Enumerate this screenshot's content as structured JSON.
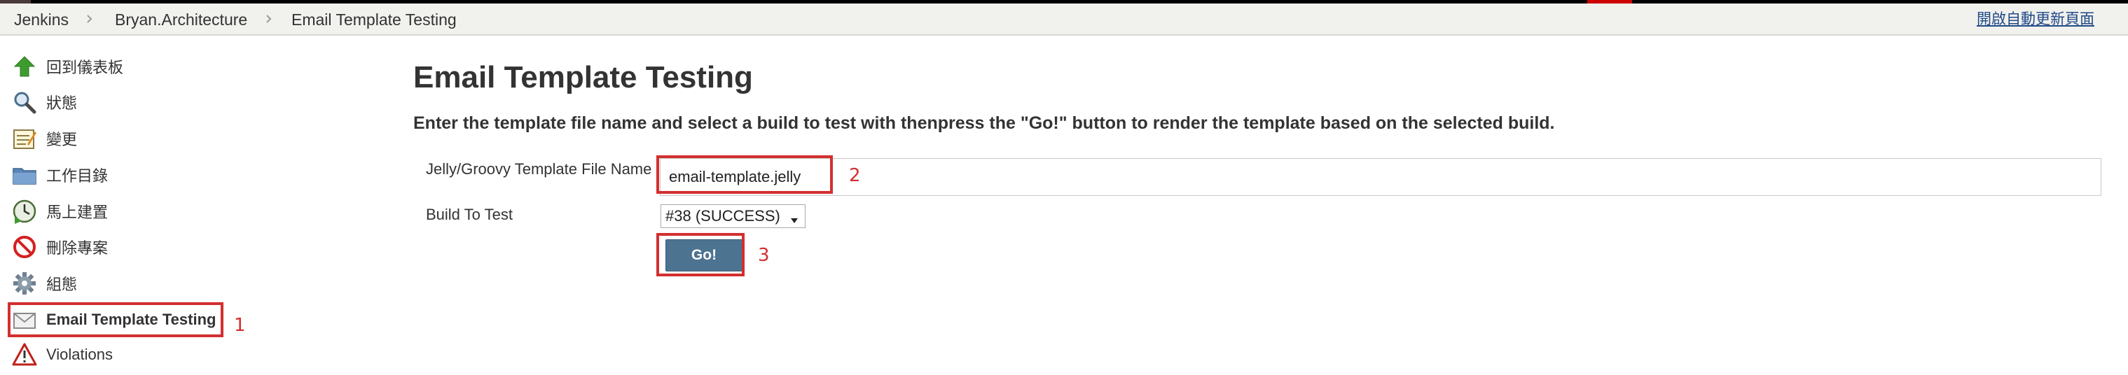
{
  "breadcrumb": {
    "items": [
      "Jenkins",
      "Bryan.Architecture",
      "Email Template Testing"
    ],
    "auto_refresh_label": "開啟自動更新頁面"
  },
  "sidebar": {
    "items": [
      {
        "label": "回到儀表板",
        "icon": "up-arrow-icon"
      },
      {
        "label": "狀態",
        "icon": "magnifier-icon"
      },
      {
        "label": "變更",
        "icon": "notepad-icon"
      },
      {
        "label": "工作目錄",
        "icon": "folder-icon"
      },
      {
        "label": "馬上建置",
        "icon": "clock-play-icon"
      },
      {
        "label": "刪除專案",
        "icon": "no-entry-icon"
      },
      {
        "label": "組態",
        "icon": "gear-icon"
      },
      {
        "label": "Email Template Testing",
        "icon": "envelope-icon"
      },
      {
        "label": "Violations",
        "icon": "warning-icon"
      }
    ]
  },
  "main": {
    "title": "Email Template Testing",
    "description": "Enter the template file name and select a build to test with thenpress the \"Go!\" button to render the template based on the selected build.",
    "template_field": {
      "label": "Jelly/Groovy Template File Name",
      "value": "email-template.jelly"
    },
    "build_field": {
      "label": "Build To Test",
      "selected": "#38 (SUCCESS)"
    },
    "go_button_label": "Go!"
  },
  "annotations": {
    "sidebar_marker": "1",
    "input_marker": "2",
    "button_marker": "3"
  },
  "colors": {
    "highlight": "#d32f2f",
    "button": "#4c7390",
    "breadcrumb_bg": "#f1f1ee",
    "link": "#204a87"
  }
}
